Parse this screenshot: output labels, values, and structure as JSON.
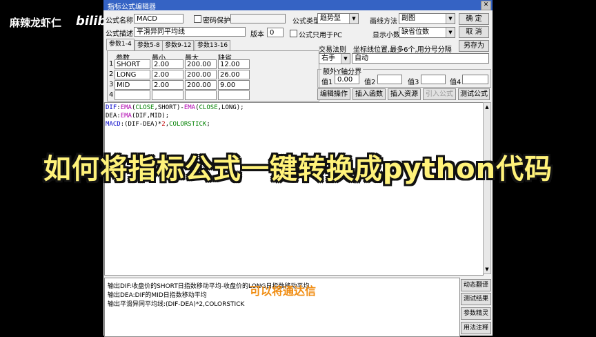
{
  "watermark": {
    "author": "麻辣龙虾仁",
    "logo": "bilib"
  },
  "window": {
    "title": "指标公式编辑器",
    "close_glyph": "✕"
  },
  "form": {
    "name_label": "公式名称",
    "name_value": "MACD",
    "password_label": "密码保护",
    "password_value": "",
    "type_label": "公式类型",
    "type_value": "趋势型",
    "draw_label": "画线方法",
    "draw_value": "副图",
    "desc_label": "公式描述",
    "desc_value": "平滑异同平均线",
    "version_label": "版本",
    "version_value": "0",
    "pc_only_label": "公式只用于PC",
    "decimals_label": "显示小数",
    "decimals_value": "缺省位数",
    "ok_label": "确  定",
    "cancel_label": "取  消",
    "save_as_label": "另存为",
    "trade_rule_label": "交易法则",
    "trade_rule_value": "右手",
    "coord_label": "坐标线位置,最多6个,用分号分隔",
    "coord_value": "自动",
    "extra_y_label": "额外Y轴分界",
    "extra_values": [
      {
        "label": "值1",
        "value": "0.00"
      },
      {
        "label": "值2",
        "value": ""
      },
      {
        "label": "值3",
        "value": ""
      },
      {
        "label": "值4",
        "value": ""
      }
    ]
  },
  "tabs": [
    "参数1-4",
    "参数5-8",
    "参数9-12",
    "参数13-16"
  ],
  "params": {
    "headers": [
      "参数",
      "最小",
      "最大",
      "缺省"
    ],
    "rows": [
      {
        "n": "1",
        "name": "SHORT",
        "min": "2.00",
        "max": "200.00",
        "def": "12.00"
      },
      {
        "n": "2",
        "name": "LONG",
        "min": "2.00",
        "max": "200.00",
        "def": "26.00"
      },
      {
        "n": "3",
        "name": "MID",
        "min": "2.00",
        "max": "200.00",
        "def": "9.00"
      },
      {
        "n": "4",
        "name": "",
        "min": "",
        "max": "",
        "def": ""
      }
    ]
  },
  "actions": [
    "编辑操作",
    "插入函数",
    "插入资源",
    "引入公式",
    "测试公式"
  ],
  "code": {
    "l1": {
      "a": "DIF",
      "b": ":",
      "c": "EMA",
      "d": "(",
      "e": "CLOSE",
      "f": ",SHORT)-",
      "g": "EMA",
      "h": "(",
      "i": "CLOSE",
      "j": ",LONG);"
    },
    "l2": {
      "a": "DEA",
      "b": ":",
      "c": "EMA",
      "d": "(DIF,MID);"
    },
    "l3": {
      "a": "MACD",
      "b": ":(DIF-DEA)*",
      "c": "2",
      "d": ",",
      "e": "COLORSTICK",
      "f": ";"
    }
  },
  "description": [
    "输出DIF:收盘价的SHORT日指数移动平均-收盘价的LONG日指数移动平均",
    "输出DEA:DIF的MID日指数移动平均",
    "输出平滑异同平均线:(DIF-DEA)*2,COLORSTICK"
  ],
  "side_buttons": [
    "动态翻译",
    "测试结果",
    "参数精灵",
    "用法注释"
  ],
  "overlay": {
    "headline": "如何将指标公式一键转换成python代码",
    "subtitle": "可以将通达信"
  },
  "colors": {
    "titlebar": "#3563c4",
    "headline": "#fff27a",
    "subtitle": "#f08c10"
  }
}
